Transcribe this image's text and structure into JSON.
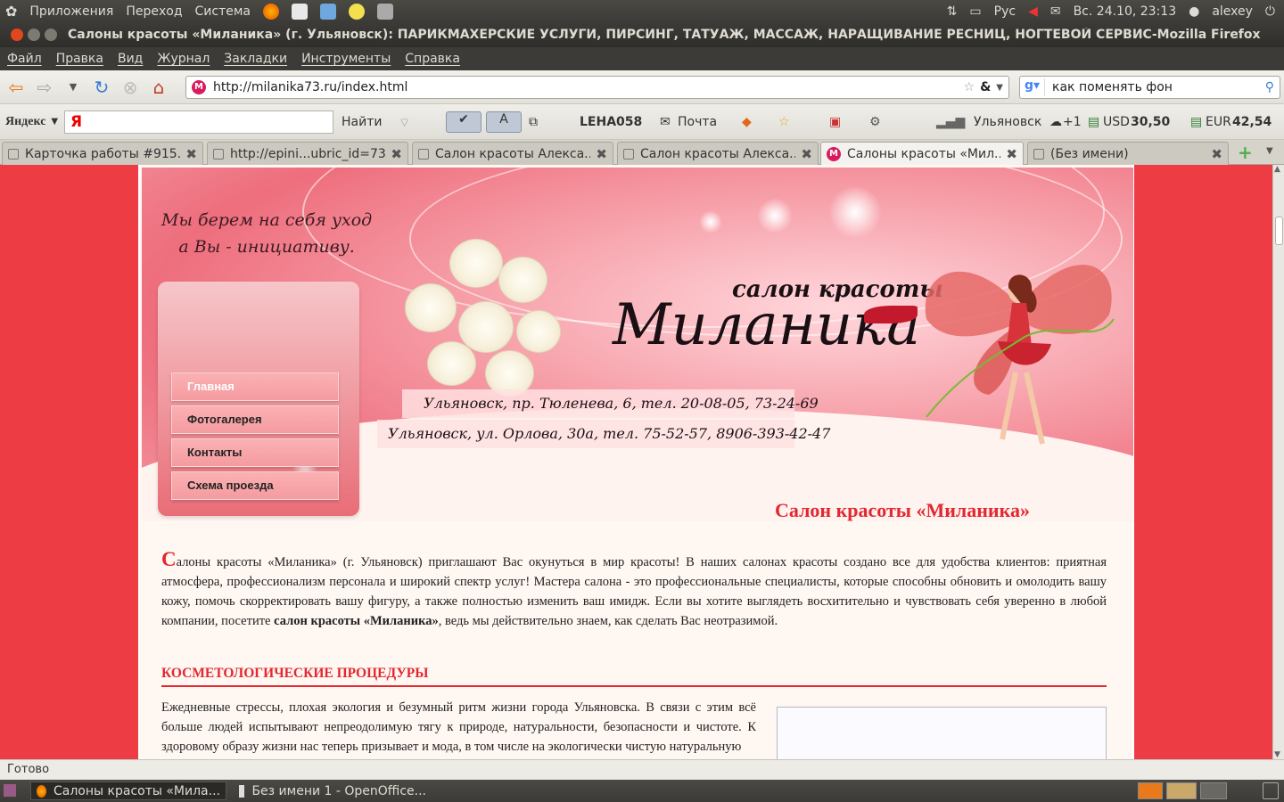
{
  "panel": {
    "menus": [
      "Приложения",
      "Переход",
      "Система"
    ],
    "keyboard_layout": "Рус",
    "datetime": "Вс. 24.10, 23:13",
    "user": "alexey"
  },
  "window": {
    "title": "Салоны красоты «Миланика» (г. Ульяновск): ПАРИКМАХЕРСКИЕ УСЛУГИ, ПИРСИНГ, ТАТУАЖ, МАССАЖ, НАРАЩИВАНИЕ РЕСНИЦ, НОГТЕВОЙ СЕРВИС-Mozilla Firefox"
  },
  "menubar": [
    "Файл",
    "Правка",
    "Вид",
    "Журнал",
    "Закладки",
    "Инструменты",
    "Справка"
  ],
  "navigation": {
    "url": "http://milanika73.ru/index.html",
    "search_value": "как поменять фон"
  },
  "yandex_bar": {
    "logo": "Яндекс",
    "input_letter": "Я",
    "find": "Найти",
    "user": "LEHA058",
    "mail": "Почта",
    "city": "Ульяновск",
    "weather": "+1",
    "usd_label": "USD",
    "usd_value": "30,50",
    "eur_label": "EUR",
    "eur_value": "42,54"
  },
  "tabs": [
    {
      "label": "Карточка работы #915..."
    },
    {
      "label": "http://epini...ubric_id=73"
    },
    {
      "label": "Салон красоты Алекса..."
    },
    {
      "label": "Салон красоты Алекса..."
    },
    {
      "label": "Салоны красоты «Мил..."
    },
    {
      "label": "(Без имени)"
    }
  ],
  "site": {
    "tagline_line1": "Мы берем на себя уход",
    "tagline_line2": "а Вы - инициативу.",
    "logo_small": "салон красоты",
    "logo_big": "Миланика",
    "address1": "Ульяновск, пр. Тюленева, 6, тел. 20-08-05, 73-24-69",
    "address2": "Ульяновск, ул. Орлова, 30а, тел. 75-52-57, 8906-393-42-47",
    "menu": [
      "Главная",
      "Фотогалерея",
      "Контакты",
      "Схема проезда"
    ],
    "page_title": "Салон красоты «Миланика»",
    "intro_dropcap": "С",
    "intro_text": "алоны красоты «Миланика» (г. Ульяновск) приглашают Вас окунуться в мир красоты! В наших салонах красоты создано все для удобства клиентов: приятная атмосфера, профессионализм персонала и широкий спектр услуг! Мастера салона - это профессиональные специалисты, которые способны обновить и омолодить вашу кожу, помочь скорректировать вашу фигуру, а также полностью изменить ваш имидж. Если вы хотите выглядеть восхитительно и чувствовать себя уверенно в любой компании, посетите ",
    "intro_bold": "салон красоты «Миланика»",
    "intro_end": ", ведь мы действительно знаем, как сделать Вас неотразимой.",
    "section_heading": "КОСМЕТОЛОГИЧЕСКИЕ ПРОЦЕДУРЫ",
    "section_text": "Ежедневные стрессы, плохая экология и безумный ритм жизни города Ульяновска. В связи с этим всё больше людей испытывают непреодолимую тягу к природе, натуральности, безопасности и чистоте. К здоровому образу жизни нас теперь призывает и мода, в том числе на экологически чистую натуральную"
  },
  "status": "Готово",
  "taskbar": [
    {
      "label": "Салоны красоты «Мила..."
    },
    {
      "label": "Без имени 1 - OpenOffice..."
    }
  ],
  "colors": {
    "page_background": "#ed3c44",
    "accent_red": "#e4262f",
    "panel_dark": "#3c3b37"
  }
}
